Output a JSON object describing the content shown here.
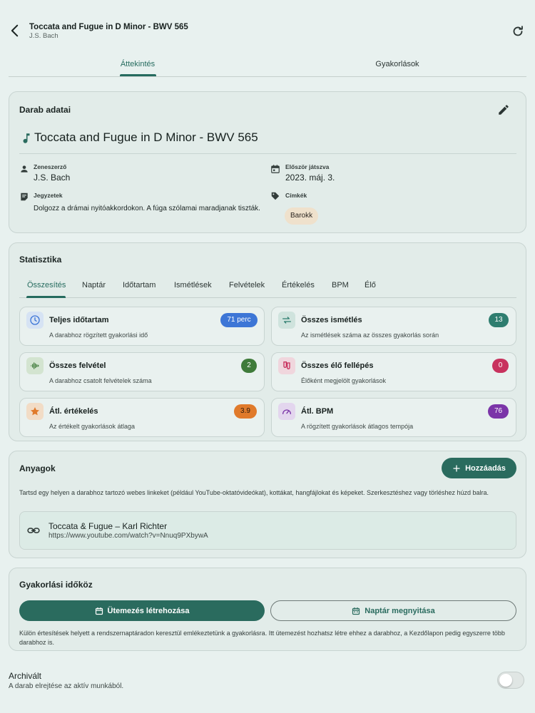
{
  "header": {
    "title": "Toccata and Fugue in D Minor - BWV 565",
    "subtitle": "J.S. Bach"
  },
  "tabs": [
    {
      "label": "Áttekintés",
      "active": true
    },
    {
      "label": "Gyakorlások",
      "active": false
    }
  ],
  "details": {
    "section_title": "Darab adatai",
    "piece_title": "Toccata and Fugue in D Minor - BWV 565",
    "composer_label": "Zeneszerző",
    "composer_value": "J.S. Bach",
    "first_played_label": "Először játszva",
    "first_played_value": "2023. máj. 3.",
    "notes_label": "Jegyzetek",
    "notes_value": "Dolgozz a drámai nyitóakkordokon. A fúga szólamai maradjanak tiszták.",
    "tags_label": "Címkék",
    "tags": [
      "Barokk"
    ]
  },
  "stats": {
    "section_title": "Statisztika",
    "tabs": [
      "Összesítés",
      "Naptár",
      "Időtartam",
      "Ismétlések",
      "Felvételek",
      "Értékelés",
      "BPM",
      "Élő"
    ],
    "cards": [
      {
        "title": "Teljes időtartam",
        "desc": "A darabhoz rögzített gyakorlási idő",
        "badge": "71 perc",
        "color": "#3d76d6",
        "icon": "clock-icon"
      },
      {
        "title": "Összes ismétlés",
        "desc": "Az ismétlések száma az összes gyakorlás során",
        "badge": "13",
        "color": "#2e7d6f",
        "icon": "repeat-icon"
      },
      {
        "title": "Összes felvétel",
        "desc": "A darabhoz csatolt felvételek száma",
        "badge": "2",
        "color": "#3f7b3a",
        "icon": "waveform-icon"
      },
      {
        "title": "Összes élő fellépés",
        "desc": "Élőként megjelölt gyakorlások",
        "badge": "0",
        "color": "#c8325e",
        "icon": "theater-icon"
      },
      {
        "title": "Átl. értékelés",
        "desc": "Az értékelt gyakorlások átlaga",
        "badge": "3.9",
        "color": "#e07a2b",
        "icon": "star-icon"
      },
      {
        "title": "Átl. BPM",
        "desc": "A rögzített gyakorlások átlagos tempója",
        "badge": "76",
        "color": "#7b35a8",
        "icon": "speedometer-icon"
      }
    ]
  },
  "materials": {
    "section_title": "Anyagok",
    "add_label": "Hozzáadás",
    "desc": "Tartsd egy helyen a darabhoz tartozó webes linkeket (például YouTube-oktatóvideókat), kottákat, hangfájlokat és képeket. Szerkesztéshez vagy törléshez húzd balra.",
    "items": [
      {
        "title": "Toccata & Fugue – Karl Richter",
        "url": "https://www.youtube.com/watch?v=Nnuq9PXbywA"
      }
    ]
  },
  "schedule": {
    "section_title": "Gyakorlási időköz",
    "create_label": "Ütemezés létrehozása",
    "open_label": "Naptár megnyitása",
    "desc": "Külön értesítések helyett a rendszernaptáradon keresztül emlékeztetünk a gyakorlásra. Itt ütemezést hozhatsz létre ehhez a darabhoz, a Kezdőlapon pedig egyszerre több darabhoz is."
  },
  "archive": {
    "title": "Archivált",
    "desc": "A darab elrejtése az aktív munkából.",
    "enabled": false
  }
}
